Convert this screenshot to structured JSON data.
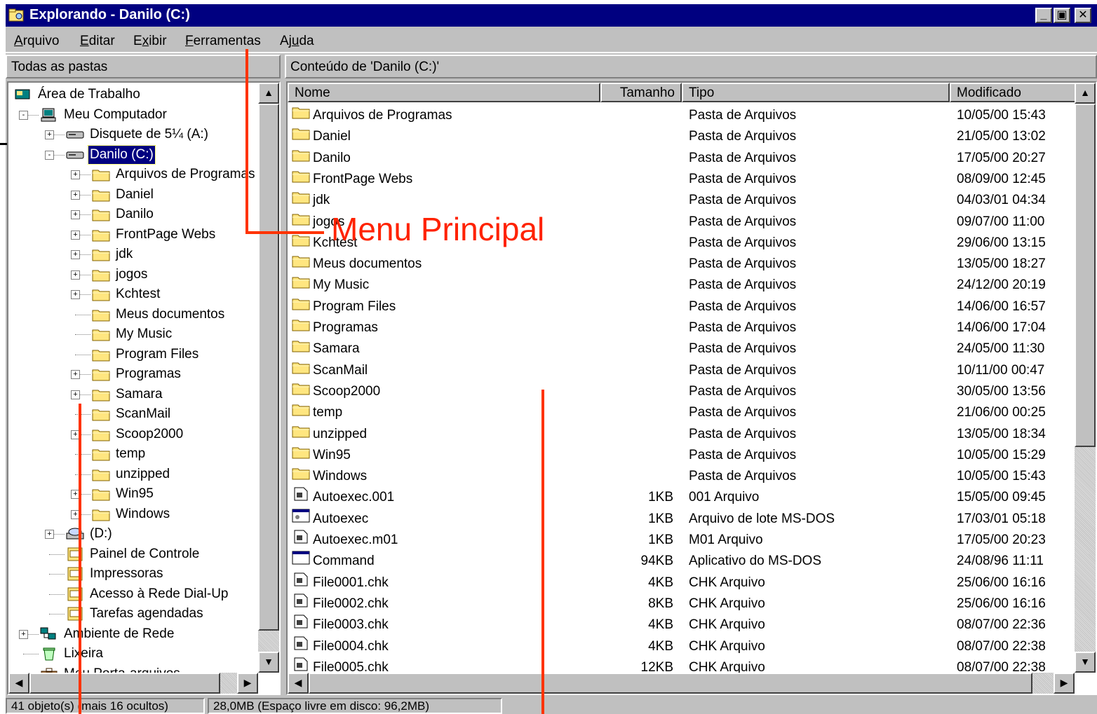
{
  "window": {
    "title": "Explorando - Danilo (C:)",
    "controls": [
      "_",
      "▣",
      "✕"
    ]
  },
  "menu": {
    "items": [
      {
        "underline": "A",
        "rest": "rquivo"
      },
      {
        "underline": "E",
        "rest": "ditar"
      },
      {
        "prefix": "E",
        "underline": "x",
        "rest": "ibir"
      },
      {
        "underline": "F",
        "rest": "erramentas"
      },
      {
        "prefix": "Aj",
        "underline": "u",
        "rest": "da"
      }
    ]
  },
  "tree_header": "Todas as pastas",
  "list_header": "Conteúdo de 'Danilo (C:)'",
  "tree": [
    {
      "label": "Área de Trabalho",
      "icon": "desktop-icon"
    },
    {
      "label": "Meu Computador",
      "icon": "computer-icon",
      "expander": "-"
    },
    {
      "label": "Disquete de 5¼ (A:)",
      "icon": "floppy-drive-icon",
      "expander": "+"
    },
    {
      "label": "Danilo (C:)",
      "icon": "hard-drive-icon",
      "expander": "-",
      "selected": true
    },
    {
      "label": "Arquivos de Programas",
      "icon": "folder-icon",
      "expander": "+"
    },
    {
      "label": "Daniel",
      "icon": "folder-icon",
      "expander": "+"
    },
    {
      "label": "Danilo",
      "icon": "folder-icon",
      "expander": "+"
    },
    {
      "label": "FrontPage Webs",
      "icon": "folder-icon",
      "expander": "+"
    },
    {
      "label": "jdk",
      "icon": "folder-icon",
      "expander": "+"
    },
    {
      "label": "jogos",
      "icon": "folder-icon",
      "expander": "+"
    },
    {
      "label": "Kchtest",
      "icon": "folder-icon",
      "expander": "+"
    },
    {
      "label": "Meus documentos",
      "icon": "folder-icon"
    },
    {
      "label": "My Music",
      "icon": "folder-icon"
    },
    {
      "label": "Program Files",
      "icon": "folder-icon"
    },
    {
      "label": "Programas",
      "icon": "folder-icon",
      "expander": "+"
    },
    {
      "label": "Samara",
      "icon": "folder-icon",
      "expander": "+"
    },
    {
      "label": "ScanMail",
      "icon": "folder-icon"
    },
    {
      "label": "Scoop2000",
      "icon": "folder-icon",
      "expander": "+"
    },
    {
      "label": "temp",
      "icon": "folder-icon"
    },
    {
      "label": "unzipped",
      "icon": "folder-icon"
    },
    {
      "label": "Win95",
      "icon": "folder-icon",
      "expander": "+"
    },
    {
      "label": "Windows",
      "icon": "folder-icon",
      "expander": "+"
    },
    {
      "label": "(D:)",
      "icon": "cdrom-drive-icon",
      "expander": "+"
    },
    {
      "label": "Painel de Controle",
      "icon": "control-panel-icon"
    },
    {
      "label": "Impressoras",
      "icon": "printers-icon"
    },
    {
      "label": "Acesso à Rede Dial-Up",
      "icon": "dialup-network-icon"
    },
    {
      "label": "Tarefas agendadas",
      "icon": "scheduled-tasks-icon"
    },
    {
      "label": "Ambiente de Rede",
      "icon": "network-neighborhood-icon",
      "expander": "+"
    },
    {
      "label": "Lixeira",
      "icon": "recycle-bin-icon"
    },
    {
      "label": "Meu Porta-arquivos",
      "icon": "briefcase-icon"
    }
  ],
  "columns": [
    "Nome",
    "Tamanho",
    "Tipo",
    "Modificado"
  ],
  "files": [
    {
      "name": "Arquivos de Programas",
      "size": "",
      "type": "Pasta de Arquivos",
      "modified": "10/05/00 15:43",
      "icon": "folder-icon"
    },
    {
      "name": "Daniel",
      "size": "",
      "type": "Pasta de Arquivos",
      "modified": "21/05/00 13:02",
      "icon": "folder-icon"
    },
    {
      "name": "Danilo",
      "size": "",
      "type": "Pasta de Arquivos",
      "modified": "17/05/00 20:27",
      "icon": "folder-icon"
    },
    {
      "name": "FrontPage Webs",
      "size": "",
      "type": "Pasta de Arquivos",
      "modified": "08/09/00 12:45",
      "icon": "folder-icon"
    },
    {
      "name": "jdk",
      "size": "",
      "type": "Pasta de Arquivos",
      "modified": "04/03/01 04:34",
      "icon": "folder-icon"
    },
    {
      "name": "jogos",
      "size": "",
      "type": "Pasta de Arquivos",
      "modified": "09/07/00 11:00",
      "icon": "folder-icon"
    },
    {
      "name": "Kchtest",
      "size": "",
      "type": "Pasta de Arquivos",
      "modified": "29/06/00 13:15",
      "icon": "folder-icon"
    },
    {
      "name": "Meus documentos",
      "size": "",
      "type": "Pasta de Arquivos",
      "modified": "13/05/00 18:27",
      "icon": "folder-icon"
    },
    {
      "name": "My Music",
      "size": "",
      "type": "Pasta de Arquivos",
      "modified": "24/12/00 20:19",
      "icon": "folder-icon"
    },
    {
      "name": "Program Files",
      "size": "",
      "type": "Pasta de Arquivos",
      "modified": "14/06/00 16:57",
      "icon": "folder-icon"
    },
    {
      "name": "Programas",
      "size": "",
      "type": "Pasta de Arquivos",
      "modified": "14/06/00 17:04",
      "icon": "folder-icon"
    },
    {
      "name": "Samara",
      "size": "",
      "type": "Pasta de Arquivos",
      "modified": "24/05/00 11:30",
      "icon": "folder-icon"
    },
    {
      "name": "ScanMail",
      "size": "",
      "type": "Pasta de Arquivos",
      "modified": "10/11/00 00:47",
      "icon": "folder-icon"
    },
    {
      "name": "Scoop2000",
      "size": "",
      "type": "Pasta de Arquivos",
      "modified": "30/05/00 13:56",
      "icon": "folder-icon"
    },
    {
      "name": "temp",
      "size": "",
      "type": "Pasta de Arquivos",
      "modified": "21/06/00 00:25",
      "icon": "folder-icon"
    },
    {
      "name": "unzipped",
      "size": "",
      "type": "Pasta de Arquivos",
      "modified": "13/05/00 18:34",
      "icon": "folder-icon"
    },
    {
      "name": "Win95",
      "size": "",
      "type": "Pasta de Arquivos",
      "modified": "10/05/00 15:29",
      "icon": "folder-icon"
    },
    {
      "name": "Windows",
      "size": "",
      "type": "Pasta de Arquivos",
      "modified": "10/05/00 15:43",
      "icon": "folder-icon"
    },
    {
      "name": "Autoexec.001",
      "size": "1KB",
      "type": "001 Arquivo",
      "modified": "15/05/00 09:45",
      "icon": "file-icon"
    },
    {
      "name": "Autoexec",
      "size": "1KB",
      "type": "Arquivo de lote MS-DOS",
      "modified": "17/03/01 05:18",
      "icon": "batch-file-icon"
    },
    {
      "name": "Autoexec.m01",
      "size": "1KB",
      "type": "M01 Arquivo",
      "modified": "17/05/00 20:23",
      "icon": "file-icon"
    },
    {
      "name": "Command",
      "size": "94KB",
      "type": "Aplicativo do MS-DOS",
      "modified": "24/08/96 11:11",
      "icon": "msdos-app-icon"
    },
    {
      "name": "File0001.chk",
      "size": "4KB",
      "type": "CHK Arquivo",
      "modified": "25/06/00 16:16",
      "icon": "file-icon"
    },
    {
      "name": "File0002.chk",
      "size": "8KB",
      "type": "CHK Arquivo",
      "modified": "25/06/00 16:16",
      "icon": "file-icon"
    },
    {
      "name": "File0003.chk",
      "size": "4KB",
      "type": "CHK Arquivo",
      "modified": "08/07/00 22:36",
      "icon": "file-icon"
    },
    {
      "name": "File0004.chk",
      "size": "4KB",
      "type": "CHK Arquivo",
      "modified": "08/07/00 22:38",
      "icon": "file-icon"
    },
    {
      "name": "File0005.chk",
      "size": "12KB",
      "type": "CHK Arquivo",
      "modified": "08/07/00 22:38",
      "icon": "file-icon"
    }
  ],
  "status": {
    "objects": "41 objeto(s) (mais 16 ocultos)",
    "size": "28,0MB (Espaço livre em disco: 96,2MB)"
  },
  "annotation": {
    "label": "Menu Principal",
    "color": "#ff3300"
  },
  "colors": {
    "titlebar": "#000080",
    "face": "#c0c0c0",
    "folder": "#ffe680"
  }
}
